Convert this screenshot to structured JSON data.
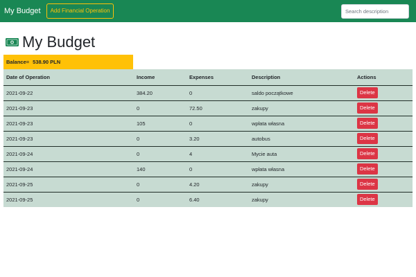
{
  "navbar": {
    "brand": "My Budget",
    "add_button": "Add Financial Operation",
    "search_placeholder": "Search description"
  },
  "page": {
    "title": "My Budget",
    "icon": "money-bill-icon",
    "balance_label": "Balance=",
    "balance_value": "538.90 PLN"
  },
  "colors": {
    "navbar": "#198754",
    "accent": "#ffc107",
    "table_bg": "#c7dbd2",
    "delete": "#dc3545"
  },
  "table": {
    "headers": [
      "Date of Operation",
      "Income",
      "Expenses",
      "Description",
      "Actions"
    ],
    "delete_label": "Delete",
    "rows": [
      {
        "date": "2021-09-22",
        "income": "384.20",
        "expenses": "0",
        "description": "saldo początkowe"
      },
      {
        "date": "2021-09-23",
        "income": "0",
        "expenses": "72.50",
        "description": "zakupy"
      },
      {
        "date": "2021-09-23",
        "income": "105",
        "expenses": "0",
        "description": "wpłata własna"
      },
      {
        "date": "2021-09-23",
        "income": "0",
        "expenses": "3.20",
        "description": "autobus"
      },
      {
        "date": "2021-09-24",
        "income": "0",
        "expenses": "4",
        "description": "Mycie auta"
      },
      {
        "date": "2021-09-24",
        "income": "140",
        "expenses": "0",
        "description": "wpłata własna"
      },
      {
        "date": "2021-09-25",
        "income": "0",
        "expenses": "4.20",
        "description": "zakupy"
      },
      {
        "date": "2021-09-25",
        "income": "0",
        "expenses": "6.40",
        "description": "zakupy"
      }
    ]
  }
}
